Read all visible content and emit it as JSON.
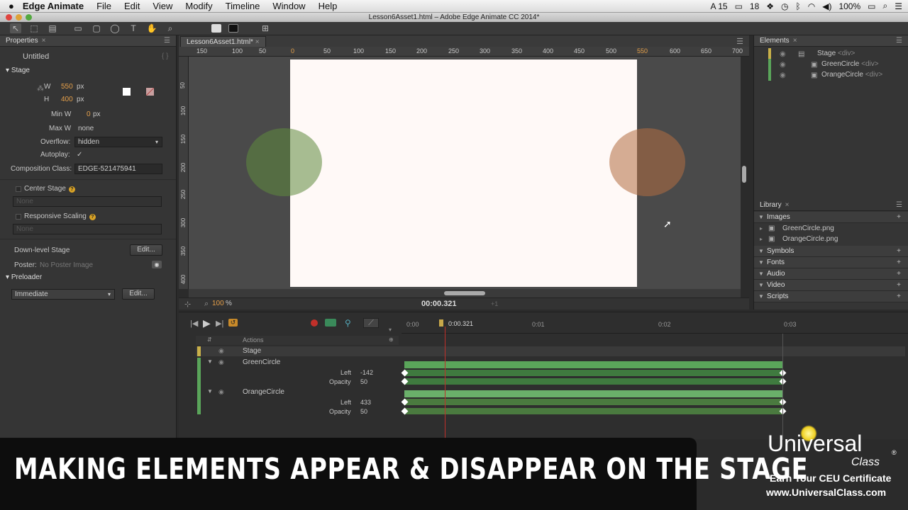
{
  "menubar": {
    "app": "Edge Animate",
    "items": [
      "File",
      "Edit",
      "View",
      "Modify",
      "Timeline",
      "Window",
      "Help"
    ],
    "status": {
      "a15": "A 15",
      "notif": "18",
      "battery": "100%"
    }
  },
  "window_title": "Lesson6Asset1.html – Adobe Edge Animate CC 2014*",
  "properties": {
    "tab": "Properties",
    "name": "Untitled",
    "stage_section": "Stage",
    "w_label": "W",
    "w_value": "550",
    "w_unit": "px",
    "h_label": "H",
    "h_value": "400",
    "h_unit": "px",
    "minw_label": "Min W",
    "minw_value": "0",
    "minw_unit": "px",
    "maxw_label": "Max W",
    "maxw_value": "none",
    "overflow_label": "Overflow:",
    "overflow_value": "hidden",
    "autoplay_label": "Autoplay:",
    "autoplay_value": "✓",
    "compclass_label": "Composition Class:",
    "compclass_value": "EDGE-521475941",
    "center_stage": "Center Stage",
    "center_none": "None",
    "responsive": "Responsive Scaling",
    "responsive_none": "None",
    "downlevel": "Down-level Stage",
    "edit": "Edit...",
    "poster_label": "Poster:",
    "poster_value": "No Poster Image",
    "preloader": "Preloader",
    "preloader_value": "Immediate"
  },
  "document": {
    "tab": "Lesson6Asset1.html*",
    "hruler": [
      "150",
      "100",
      "50",
      "0",
      "50",
      "100",
      "150",
      "200",
      "250",
      "300",
      "350",
      "400",
      "450",
      "500",
      "550",
      "600",
      "650",
      "700"
    ],
    "vruler": [
      "50",
      "100",
      "150",
      "200",
      "250",
      "300",
      "350",
      "400"
    ],
    "zoom": "100",
    "zoom_unit": "%",
    "time": "00:00.321",
    "step": "+1"
  },
  "elements_panel": {
    "tab": "Elements",
    "items": [
      {
        "name": "Stage",
        "tag": "<div>"
      },
      {
        "name": "GreenCircle",
        "tag": "<div>"
      },
      {
        "name": "OrangeCircle",
        "tag": "<div>"
      }
    ]
  },
  "library_panel": {
    "tab": "Library",
    "sections": [
      "Images",
      "Symbols",
      "Fonts",
      "Audio",
      "Video",
      "Scripts"
    ],
    "images": [
      "GreenCircle.png",
      "OrangeCircle.png"
    ]
  },
  "timeline": {
    "ticks": [
      "0:00",
      "0:00.321",
      "0:01",
      "0:02",
      "0:03"
    ],
    "actions": "Actions",
    "rows": [
      {
        "label": "Stage"
      },
      {
        "label": "GreenCircle",
        "props": [
          {
            "name": "Left",
            "value": "-142"
          },
          {
            "name": "Opacity",
            "value": "50"
          }
        ]
      },
      {
        "label": "OrangeCircle",
        "props": [
          {
            "name": "Left",
            "value": "433"
          },
          {
            "name": "Opacity",
            "value": "50"
          }
        ]
      }
    ]
  },
  "overlay": {
    "banner": "MAKING ELEMENTS APPEAR & DISAPPEAR ON THE STAGE",
    "logo_line1": "Universal",
    "logo_line2": "Class",
    "logo_reg": "®",
    "cert": "Earn Your CEU Certificate",
    "url": "www.UniversalClass.com"
  },
  "colors": {
    "green_circle": "#5e8a3e",
    "orange_circle": "#b36d42",
    "timeline_green": "#5aa55a",
    "playhead": "#c0302a"
  }
}
